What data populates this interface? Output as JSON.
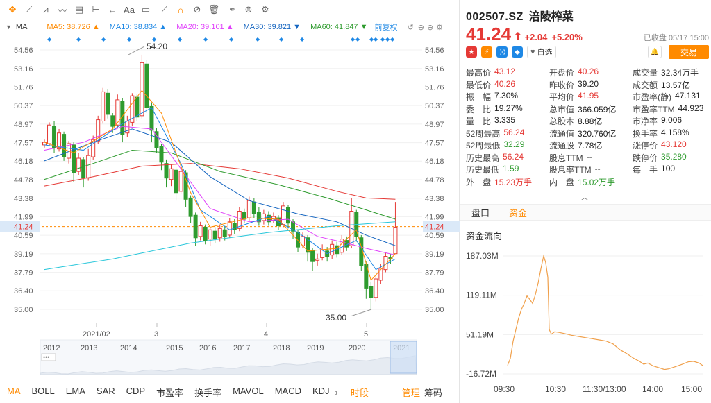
{
  "toolbar": {
    "icons": [
      "move-icon",
      "line-tool-icon",
      "polyline-tool-icon",
      "trend-tool-icon",
      "rect-tool-icon",
      "range-tool-icon",
      "arrow-tool-icon"
    ],
    "text_tool": "Aa"
  },
  "ma": {
    "label": "MA",
    "items": [
      {
        "name": "MA5",
        "value": "38.726",
        "dir": "▲",
        "color": "#ff8a00"
      },
      {
        "name": "MA10",
        "value": "38.834",
        "dir": "▲",
        "color": "#1e88e5"
      },
      {
        "name": "MA20",
        "value": "39.101",
        "dir": "▲",
        "color": "#e040fb"
      },
      {
        "name": "MA30",
        "value": "39.821",
        "dir": "▼",
        "color": "#1565c0"
      },
      {
        "name": "MA60",
        "value": "41.847",
        "dir": "▼",
        "color": "#2e9b2e"
      }
    ],
    "adjust": "前复权"
  },
  "chart_data": {
    "type": "candlestick",
    "y_ticks": [
      "54.56",
      "53.16",
      "51.76",
      "50.37",
      "48.97",
      "47.57",
      "46.18",
      "44.78",
      "43.38",
      "41.99",
      "40.59",
      "39.19",
      "37.79",
      "36.40",
      "35.00"
    ],
    "ylim": [
      35.0,
      54.56
    ],
    "current_price_label": "41.24",
    "high_label": "54.20",
    "low_label": "35.00",
    "x_month_labels": [
      "2021/02",
      "3",
      "4",
      "5"
    ],
    "year_labels": [
      "2012",
      "2013",
      "2014",
      "2015",
      "2016",
      "2017",
      "2018",
      "2019",
      "2020",
      "2021"
    ]
  },
  "tabs": [
    "MA",
    "BOLL",
    "EMA",
    "SAR",
    "CDP",
    "市盈率",
    "换手率",
    "MAVOL",
    "MACD",
    "KDJ"
  ],
  "tabs_right": {
    "period": "时段",
    "manage": "管理",
    "chips": "筹码"
  },
  "stock": {
    "code": "002507.SZ",
    "name": "涪陵榨菜",
    "price": "41.24",
    "change": "+2.04",
    "change_pct": "+5.20%",
    "status": "已收盘 05/17 15:00",
    "watch": "自选",
    "trade": "交易"
  },
  "stats": [
    [
      {
        "l": "最高价",
        "v": "43.12",
        "c": "red"
      },
      {
        "l": "开盘价",
        "v": "40.26",
        "c": "red"
      },
      {
        "l": "成交量",
        "v": "32.34万手",
        "c": ""
      }
    ],
    [
      {
        "l": "最低价",
        "v": "40.26",
        "c": "red"
      },
      {
        "l": "昨收价",
        "v": "39.20",
        "c": ""
      },
      {
        "l": "成交额",
        "v": "13.57亿",
        "c": ""
      }
    ],
    [
      {
        "l": "振　幅",
        "v": "7.30%",
        "c": ""
      },
      {
        "l": "平均价",
        "v": "41.95",
        "c": "red"
      },
      {
        "l": "市盈率(静)",
        "v": "47.131",
        "c": ""
      }
    ],
    [
      {
        "l": "委　比",
        "v": "19.27%",
        "c": ""
      },
      {
        "l": "总市值",
        "v": "366.059亿",
        "c": ""
      },
      {
        "l": "市盈率TTM",
        "v": "44.923",
        "c": ""
      }
    ],
    [
      {
        "l": "量　比",
        "v": "3.335",
        "c": ""
      },
      {
        "l": "总股本",
        "v": "8.88亿",
        "c": ""
      },
      {
        "l": "市净率",
        "v": "9.006",
        "c": ""
      }
    ],
    [
      {
        "l": "52周最高",
        "v": "56.24",
        "c": "red"
      },
      {
        "l": "流通值",
        "v": "320.760亿",
        "c": ""
      },
      {
        "l": "换手率",
        "v": "4.158%",
        "c": ""
      }
    ],
    [
      {
        "l": "52周最低",
        "v": "32.29",
        "c": "green"
      },
      {
        "l": "流通股",
        "v": "7.78亿",
        "c": ""
      },
      {
        "l": "涨停价",
        "v": "43.120",
        "c": "red"
      }
    ],
    [
      {
        "l": "历史最高",
        "v": "56.24",
        "c": "red"
      },
      {
        "l": "股息TTM",
        "v": "--",
        "c": ""
      },
      {
        "l": "跌停价",
        "v": "35.280",
        "c": "green"
      }
    ],
    [
      {
        "l": "历史最低",
        "v": "1.59",
        "c": "green"
      },
      {
        "l": "股息率TTM",
        "v": "--",
        "c": ""
      },
      {
        "l": "每　手",
        "v": "100",
        "c": ""
      }
    ],
    [
      {
        "l": "外　盘",
        "v": "15.23万手",
        "c": "red"
      },
      {
        "l": "内　盘",
        "v": "15.02万手",
        "c": "green"
      },
      {
        "l": "",
        "v": "",
        "c": ""
      }
    ]
  ],
  "sub_tabs": [
    "盘口",
    "资金"
  ],
  "flow": {
    "title": "资金流向",
    "y_ticks": [
      "187.03M",
      "119.11M",
      "51.19M",
      "-16.72M"
    ],
    "ylim": [
      -16.72,
      187.03
    ],
    "x_ticks": [
      "09:30",
      "10:30",
      "11:30/13:00",
      "14:00",
      "15:00"
    ]
  }
}
